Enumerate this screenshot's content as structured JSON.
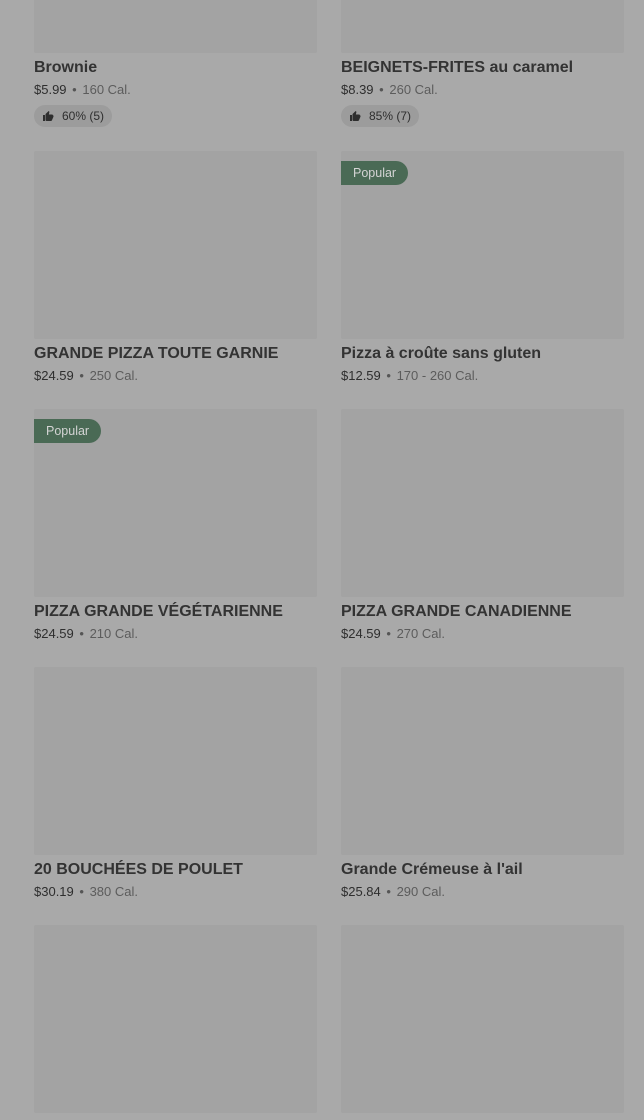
{
  "menu_items": [
    {
      "name": "Brownie",
      "price": "$5.99",
      "calories": "160 Cal.",
      "rating": "60% (5)"
    },
    {
      "name": "BEIGNETS-FRITES au caramel",
      "price": "$8.39",
      "calories": "260 Cal.",
      "rating": "85% (7)"
    },
    {
      "name": "GRANDE PIZZA TOUTE GARNIE",
      "price": "$24.59",
      "calories": "250 Cal."
    },
    {
      "name": "Pizza à croûte sans gluten",
      "price": "$12.59",
      "calories": "170 - 260 Cal.",
      "badge": "Popular"
    },
    {
      "name": "PIZZA GRANDE VÉGÉTARIENNE",
      "price": "$24.59",
      "calories": "210 Cal.",
      "badge": "Popular"
    },
    {
      "name": "PIZZA GRANDE CANADIENNE",
      "price": "$24.59",
      "calories": "270 Cal."
    },
    {
      "name": "20 BOUCHÉES DE POULET",
      "price": "$30.19",
      "calories": "380 Cal."
    },
    {
      "name": "Grande Crémeuse à l'ail",
      "price": "$25.84",
      "calories": "290 Cal."
    }
  ],
  "separator": "•",
  "icons": {
    "rating": "thumbs-up-icon"
  }
}
